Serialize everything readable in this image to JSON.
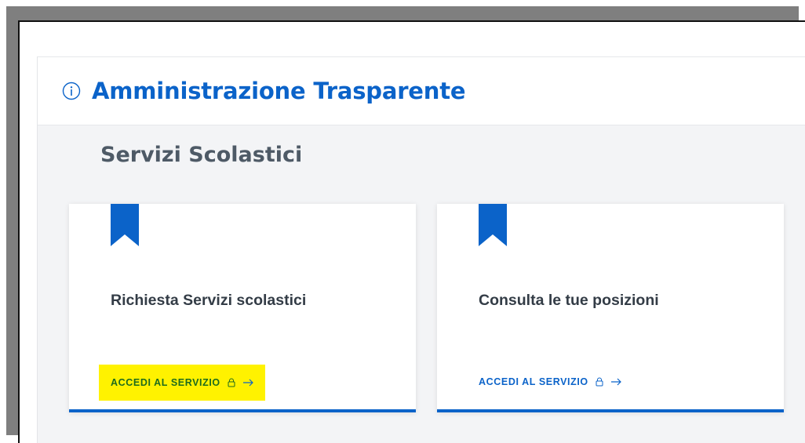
{
  "header": {
    "title": "Amministrazione Trasparente",
    "icon": "info-icon"
  },
  "section": {
    "title": "Servizi Scolastici"
  },
  "cards": [
    {
      "title": "Richiesta Servizi scolastici",
      "cta": "ACCEDI AL SERVIZIO",
      "highlighted": true
    },
    {
      "title": "Consulta le tue posizioni",
      "cta": "ACCEDI AL SERVIZIO",
      "highlighted": false
    }
  ],
  "colors": {
    "primary": "#0b63c9",
    "highlight": "#fff200",
    "heading_gray": "#4e5a66"
  }
}
